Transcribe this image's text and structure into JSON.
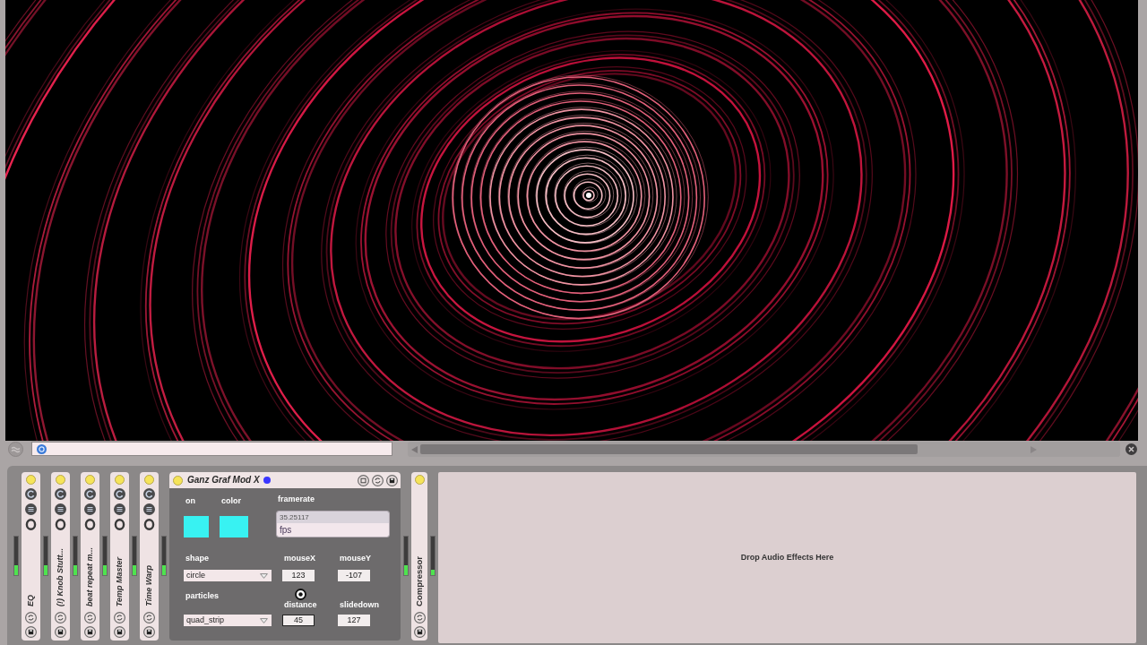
{
  "chain": {
    "input_meter": {
      "level": 0.25
    },
    "devices": [
      {
        "kind": "max_collapsed",
        "name": "EQ",
        "on": true,
        "meter": {
          "level": 0.25
        }
      },
      {
        "kind": "max_collapsed",
        "name": "(!) Knob Stutt...",
        "on": true,
        "meter": {
          "level": 0.25
        }
      },
      {
        "kind": "max_collapsed",
        "name": "beat repeat m...",
        "on": true,
        "meter": {
          "level": 0.25
        }
      },
      {
        "kind": "max_collapsed",
        "name": "Temp Master",
        "on": true,
        "meter": {
          "level": 0.25
        }
      },
      {
        "kind": "max_collapsed",
        "name": "Time Warp",
        "on": true,
        "meter": {
          "level": 0.25
        }
      },
      {
        "kind": "max_expanded",
        "name": "Ganz Graf Mod X",
        "on": true,
        "meter": {
          "level": 0.25
        },
        "controls": [
          {
            "kind": "toggle",
            "label": "on",
            "checked": true
          },
          {
            "kind": "swatch",
            "label": "color",
            "color": "#38f2f2"
          },
          {
            "kind": "display",
            "label": "framerate",
            "value": "35.25117",
            "unit": "fps"
          },
          {
            "kind": "menu",
            "label": "shape",
            "value": "circle"
          },
          {
            "kind": "number",
            "label": "mouseX",
            "value": "123",
            "selected": false
          },
          {
            "kind": "number",
            "label": "mouseY",
            "value": "-107",
            "selected": false
          },
          {
            "kind": "menu",
            "label": "particles",
            "value": "quad_strip"
          },
          {
            "kind": "number",
            "label": "distance",
            "value": "45",
            "selected": true
          },
          {
            "kind": "number",
            "label": "slidedown",
            "value": "127",
            "selected": false
          }
        ]
      },
      {
        "kind": "native_collapsed",
        "name": "Compressor",
        "on": true,
        "meter": {
          "level": 0.15
        }
      }
    ],
    "drop_hint": "Drop Audio Effects Here"
  }
}
